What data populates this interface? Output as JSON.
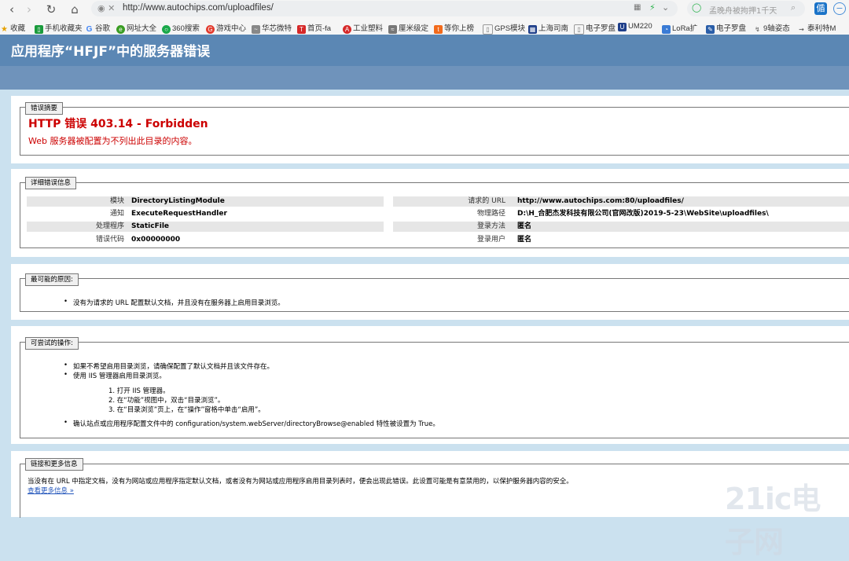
{
  "browser": {
    "url": "http://www.autochips.com/uploadfiles/",
    "search_placeholder": "孟晚舟被拘押1千天",
    "bookmarks": [
      {
        "label": "收藏"
      },
      {
        "label": "手机收藏夹"
      },
      {
        "label": "谷歌"
      },
      {
        "label": "网址大全"
      },
      {
        "label": "360搜索"
      },
      {
        "label": "游戏中心"
      },
      {
        "label": "华芯微特"
      },
      {
        "label": "首页-fa"
      },
      {
        "label": "工业塑料"
      },
      {
        "label": "厘米级定"
      },
      {
        "label": "等你上榜"
      },
      {
        "label": "GPS模块"
      },
      {
        "label": "上海司南"
      },
      {
        "label": "电子罗盘"
      },
      {
        "label": "UM220"
      },
      {
        "label": "LoRa扩"
      },
      {
        "label": "电子罗盘"
      },
      {
        "label": "9轴姿态"
      },
      {
        "label": "泰利特M"
      }
    ]
  },
  "header": {
    "title": "应用程序“HFJF”中的服务器错误"
  },
  "summary": {
    "legend": "错误摘要",
    "title": "HTTP 错误 403.14 - Forbidden",
    "message": "Web 服务器被配置为不列出此目录的内容。"
  },
  "details": {
    "legend": "详细错误信息",
    "left": [
      {
        "label": "模块",
        "value": "DirectoryListingModule"
      },
      {
        "label": "通知",
        "value": "ExecuteRequestHandler"
      },
      {
        "label": "处理程序",
        "value": "StaticFile"
      },
      {
        "label": "错误代码",
        "value": "0x00000000"
      }
    ],
    "right": [
      {
        "label": "请求的 URL",
        "value": "http://www.autochips.com:80/uploadfiles/"
      },
      {
        "label": "物理路径",
        "value": "D:\\H_合肥杰发科技有限公司(官网改版)2019-5-23\\WebSite\\uploadfiles\\"
      },
      {
        "label": "登录方法",
        "value": "匿名"
      },
      {
        "label": "登录用户",
        "value": "匿名"
      }
    ]
  },
  "causes": {
    "legend": "最可能的原因:",
    "items": [
      "没有为请求的 URL 配置默认文档，并且没有在服务器上启用目录浏览。"
    ]
  },
  "actions": {
    "legend": "可尝试的操作:",
    "items": [
      "如果不希望启用目录浏览，请确保配置了默认文档并且该文件存在。",
      "使用 IIS 管理器启用目录浏览。"
    ],
    "steps": [
      "1. 打开 IIS 管理器。",
      "2. 在“功能”视图中，双击“目录浏览”。",
      "3. 在“目录浏览”页上，在“操作”窗格中单击“启用”。"
    ],
    "last": "确认站点或应用程序配置文件中的 configuration/system.webServer/directoryBrowse@enabled 特性被设置为 True。"
  },
  "links": {
    "legend": "链接和更多信息",
    "text": "当没有在 URL 中指定文档，没有为网站或应用程序指定默认文档，或者没有为网站或应用程序启用目录列表时，便会出现此错误。此设置可能是有意禁用的，以保护服务器内容的安全。",
    "more": "查看更多信息 »"
  },
  "watermark": "21ic电子网"
}
